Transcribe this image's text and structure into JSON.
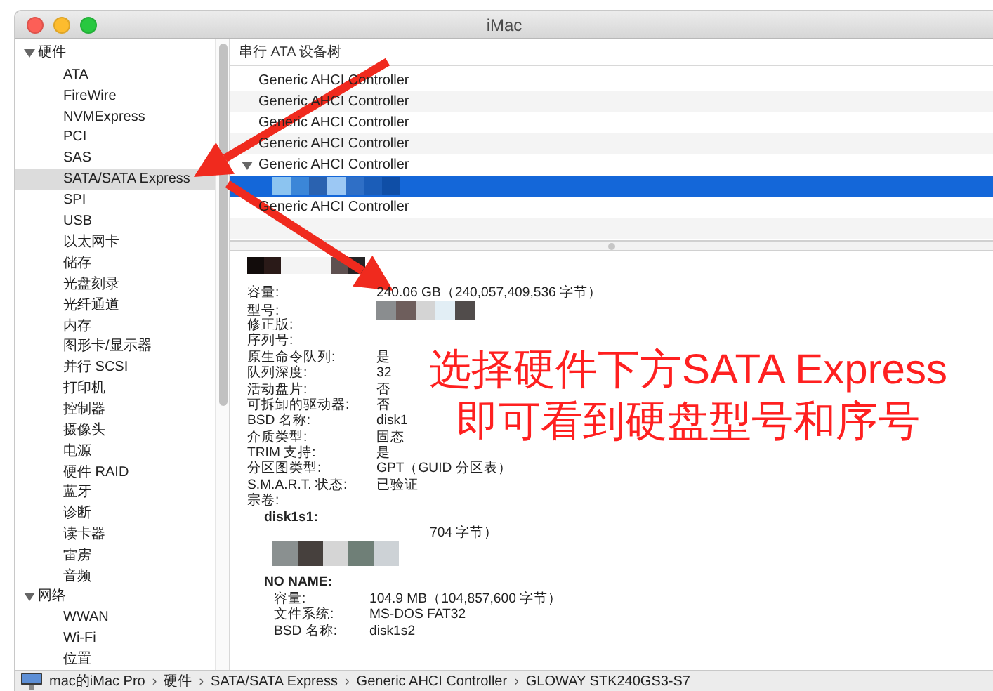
{
  "window": {
    "title": "iMac"
  },
  "sidebar": {
    "groups": [
      {
        "label": "硬件",
        "expanded": true,
        "selected": false,
        "children": [
          {
            "label": "ATA",
            "selected": false
          },
          {
            "label": "FireWire",
            "selected": false
          },
          {
            "label": "NVMExpress",
            "selected": false
          },
          {
            "label": "PCI",
            "selected": false
          },
          {
            "label": "SAS",
            "selected": false
          },
          {
            "label": "SATA/SATA Express",
            "selected": true
          },
          {
            "label": "SPI",
            "selected": false
          },
          {
            "label": "USB",
            "selected": false
          },
          {
            "label": "以太网卡",
            "selected": false
          },
          {
            "label": "储存",
            "selected": false
          },
          {
            "label": "光盘刻录",
            "selected": false
          },
          {
            "label": "光纤通道",
            "selected": false
          },
          {
            "label": "内存",
            "selected": false
          },
          {
            "label": "图形卡/显示器",
            "selected": false
          },
          {
            "label": "并行 SCSI",
            "selected": false
          },
          {
            "label": "打印机",
            "selected": false
          },
          {
            "label": "控制器",
            "selected": false
          },
          {
            "label": "摄像头",
            "selected": false
          },
          {
            "label": "电源",
            "selected": false
          },
          {
            "label": "硬件 RAID",
            "selected": false
          },
          {
            "label": "蓝牙",
            "selected": false
          },
          {
            "label": "诊断",
            "selected": false
          },
          {
            "label": "读卡器",
            "selected": false
          },
          {
            "label": "雷雳",
            "selected": false
          },
          {
            "label": "音频",
            "selected": false
          }
        ]
      },
      {
        "label": "网络",
        "expanded": true,
        "selected": false,
        "children": [
          {
            "label": "WWAN",
            "selected": false
          },
          {
            "label": "Wi-Fi",
            "selected": false
          },
          {
            "label": "位置",
            "selected": false
          }
        ]
      }
    ]
  },
  "device_tree": {
    "header": "串行 ATA 设备树",
    "rows": [
      {
        "kind": "text",
        "label": "Generic AHCI Controller",
        "selected": false
      },
      {
        "kind": "text",
        "label": "Generic AHCI Controller",
        "selected": false
      },
      {
        "kind": "text",
        "label": "Generic AHCI Controller",
        "selected": false
      },
      {
        "kind": "text",
        "label": "Generic AHCI Controller",
        "selected": false
      },
      {
        "kind": "text",
        "label": "Generic AHCI Controller",
        "selected": false,
        "expanded": true,
        "children": [
          {
            "kind": "redacted",
            "selected": true
          }
        ]
      },
      {
        "kind": "text",
        "label": "Generic AHCI Controller",
        "selected": false
      }
    ]
  },
  "details": {
    "heading": {
      "kind": "redacted"
    },
    "fields": [
      {
        "label": "容量:",
        "kind": "text",
        "value": "240.06 GB（240,057,409,536 字节）"
      },
      {
        "label": "型号:",
        "kind": "redacted"
      },
      {
        "label": "修正版:",
        "kind": "blank"
      },
      {
        "label": "序列号:",
        "kind": "blank"
      },
      {
        "label": "原生命令队列:",
        "kind": "text",
        "value": "是"
      },
      {
        "label": "队列深度:",
        "kind": "text",
        "value": "32"
      },
      {
        "label": "活动盘片:",
        "kind": "text",
        "value": "否"
      },
      {
        "label": "可拆卸的驱动器:",
        "kind": "text",
        "value": "否"
      },
      {
        "label": "BSD 名称:",
        "kind": "text",
        "value": "disk1"
      },
      {
        "label": "介质类型:",
        "kind": "text",
        "value": "固态"
      },
      {
        "label": "TRIM 支持:",
        "kind": "text",
        "value": "是"
      },
      {
        "label": "分区图类型:",
        "kind": "text",
        "value": "GPT（GUID 分区表）"
      },
      {
        "label": "S.M.A.R.T. 状态:",
        "kind": "text",
        "value": "已验证"
      },
      {
        "label": "宗卷:",
        "kind": "blank"
      }
    ],
    "volumes": [
      {
        "name": "disk1s1:",
        "fields": [
          {
            "kind": "partly_redacted",
            "value": "704 字节）"
          },
          {
            "kind": "redacted"
          }
        ]
      },
      {
        "name": "NO NAME:",
        "fields": [
          {
            "kind": "text",
            "label": "容量:",
            "value": "104.9 MB（104,857,600 字节）"
          },
          {
            "kind": "text",
            "label": "文件系统:",
            "value": "MS-DOS FAT32"
          },
          {
            "kind": "text",
            "label": "BSD 名称:",
            "value": "disk1s2"
          }
        ]
      }
    ]
  },
  "annotation": {
    "lines": [
      "选择硬件下方SATA Express",
      "即可看到硬盘型号和序号"
    ]
  },
  "path_bar": {
    "separator": "›",
    "items": [
      "mac的iMac Pro",
      "硬件",
      "SATA/SATA Express",
      "Generic AHCI Controller",
      "GLOWAY STK240GS3-S7"
    ]
  }
}
